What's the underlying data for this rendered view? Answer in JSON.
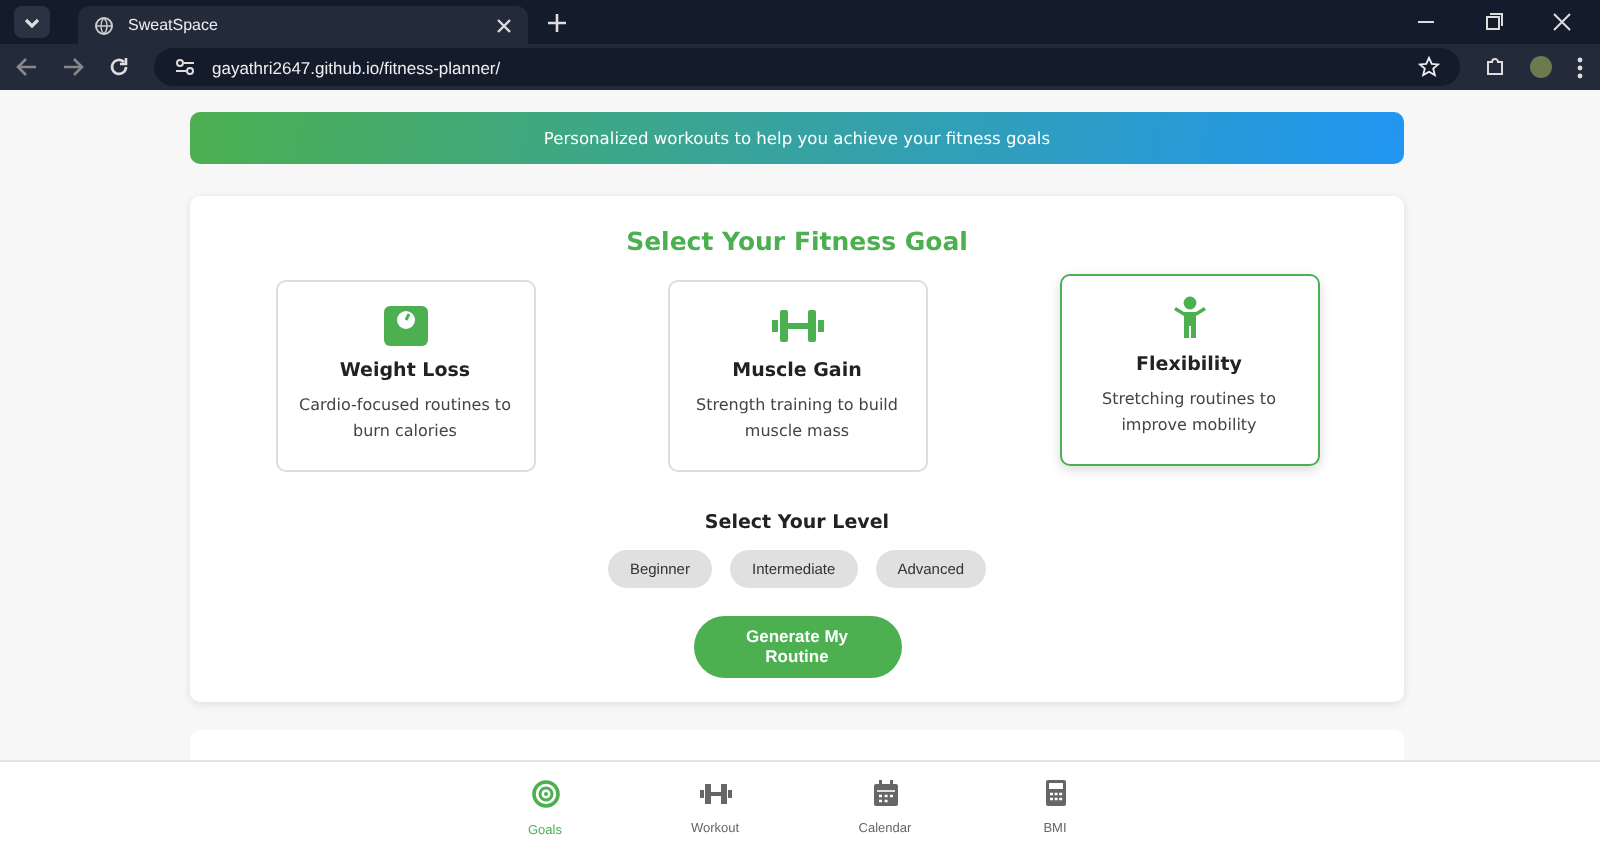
{
  "browser": {
    "tab_title": "SweatSpace",
    "url": "gayathri2647.github.io/fitness-planner/"
  },
  "banner": {
    "text": "Personalized workouts to help you achieve your fitness goals"
  },
  "goal_section": {
    "title": "Select Your Fitness Goal",
    "goals": [
      {
        "kind": "scale",
        "title": "Weight Loss",
        "description": "Cardio-focused routines to burn calories",
        "selected": false
      },
      {
        "kind": "dumbbell",
        "title": "Muscle Gain",
        "description": "Strength training to build muscle mass",
        "selected": false
      },
      {
        "kind": "person",
        "title": "Flexibility",
        "description": "Stretching routines to improve mobility",
        "selected": true
      }
    ],
    "level_title": "Select Your Level",
    "levels": [
      {
        "label": "Beginner",
        "selected": false
      },
      {
        "label": "Intermediate",
        "selected": false
      },
      {
        "label": "Advanced",
        "selected": false
      }
    ],
    "generate_button": "Generate My Routine"
  },
  "bottom_nav": [
    {
      "kind": "target",
      "label": "Goals",
      "selected": true
    },
    {
      "kind": "dumbbell",
      "label": "Workout",
      "selected": false
    },
    {
      "kind": "calendar",
      "label": "Calendar",
      "selected": false
    },
    {
      "kind": "calculator",
      "label": "BMI",
      "selected": false
    }
  ]
}
